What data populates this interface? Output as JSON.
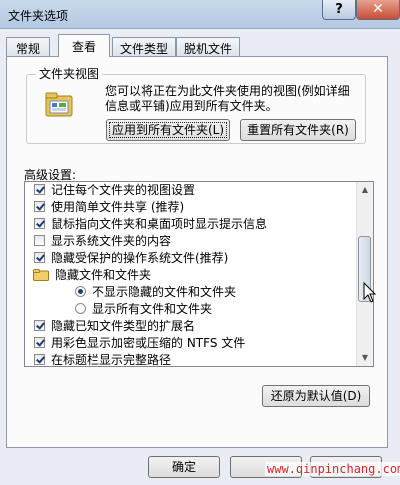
{
  "window": {
    "title": "文件夹选项",
    "help_glyph": "?",
    "close_glyph": "✕"
  },
  "tabs": [
    {
      "label": "常规",
      "active": false
    },
    {
      "label": "查看",
      "active": true
    },
    {
      "label": "文件类型",
      "active": false
    },
    {
      "label": "脱机文件",
      "active": false
    }
  ],
  "folder_views": {
    "group_label": "文件夹视图",
    "description": "您可以将正在为此文件夹使用的视图(例如详细信息或平铺)应用到所有文件夹。",
    "apply_button": "应用到所有文件夹(L)",
    "reset_button": "重置所有文件夹(R)"
  },
  "advanced": {
    "label": "高级设置:",
    "items": [
      {
        "type": "checkbox",
        "label": "记住每个文件夹的视图设置",
        "checked": true
      },
      {
        "type": "checkbox",
        "label": "使用简单文件共享 (推荐)",
        "checked": true
      },
      {
        "type": "checkbox",
        "label": "鼠标指向文件夹和桌面项时显示提示信息",
        "checked": true
      },
      {
        "type": "checkbox",
        "label": "显示系统文件夹的内容",
        "checked": false
      },
      {
        "type": "checkbox",
        "label": "隐藏受保护的操作系统文件(推荐)",
        "checked": true
      },
      {
        "type": "folder",
        "label": "隐藏文件和文件夹"
      },
      {
        "type": "radio",
        "label": "不显示隐藏的文件和文件夹",
        "checked": true
      },
      {
        "type": "radio",
        "label": "显示所有文件和文件夹",
        "checked": false
      },
      {
        "type": "checkbox",
        "label": "隐藏已知文件类型的扩展名",
        "checked": true
      },
      {
        "type": "checkbox",
        "label": "用彩色显示加密或压缩的 NTFS 文件",
        "checked": true
      },
      {
        "type": "checkbox",
        "label": "在标题栏显示完整路径",
        "checked": true
      }
    ],
    "restore_button": "还原为默认值(D)"
  },
  "footer": {
    "ok_button": "确定",
    "watermark": "www.qinpinchang.com"
  }
}
